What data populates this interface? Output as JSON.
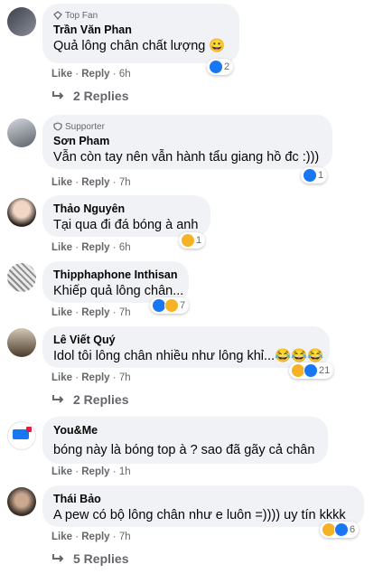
{
  "comments": [
    {
      "badge": "Top Fan",
      "name": "Trần Văn Phan",
      "text": "Quả lông chân chất lượng 😀",
      "like": "Like",
      "reply": "Reply",
      "time": "6h",
      "reaction_count": "2",
      "replies": "2 Replies"
    },
    {
      "badge": "Supporter",
      "name": "Sơn Pham",
      "text": "Vẫn còn tay nên vẫn hành tẩu giang hồ đc :)))",
      "like": "Like",
      "reply": "Reply",
      "time": "7h",
      "reaction_count": "1"
    },
    {
      "name": "Thảo Nguyên",
      "text": "Tại qua đi đá bóng à anh",
      "like": "Like",
      "reply": "Reply",
      "time": "6h",
      "reaction_count": "1"
    },
    {
      "name": "Thipphaphone Inthisan",
      "text": "Khiếp quả lông chân...",
      "like": "Like",
      "reply": "Reply",
      "time": "7h",
      "reaction_count": "7"
    },
    {
      "name": "Lê Viết Quý",
      "text": "Idol tôi lông chân nhiều như lông khỉ...😂😂😂",
      "like": "Like",
      "reply": "Reply",
      "time": "7h",
      "reaction_count": "21",
      "replies": "2 Replies"
    },
    {
      "name": "You&Me",
      "text": "bóng này là bóng top à ? sao đã gãy cả chân",
      "like": "Like",
      "reply": "Reply",
      "time": "1h"
    },
    {
      "name": "Thái Bảo",
      "text": "A pew có bộ lông chân như e luôn =)))) uy tín kkkk",
      "like": "Like",
      "reply": "Reply",
      "time": "7h",
      "reaction_count": "6",
      "replies": "5 Replies"
    }
  ],
  "colors": {
    "like_blue": "#1877f2",
    "haha_yellow": "#f7b125",
    "bubble": "#f0f2f5",
    "meta": "#65676b"
  }
}
